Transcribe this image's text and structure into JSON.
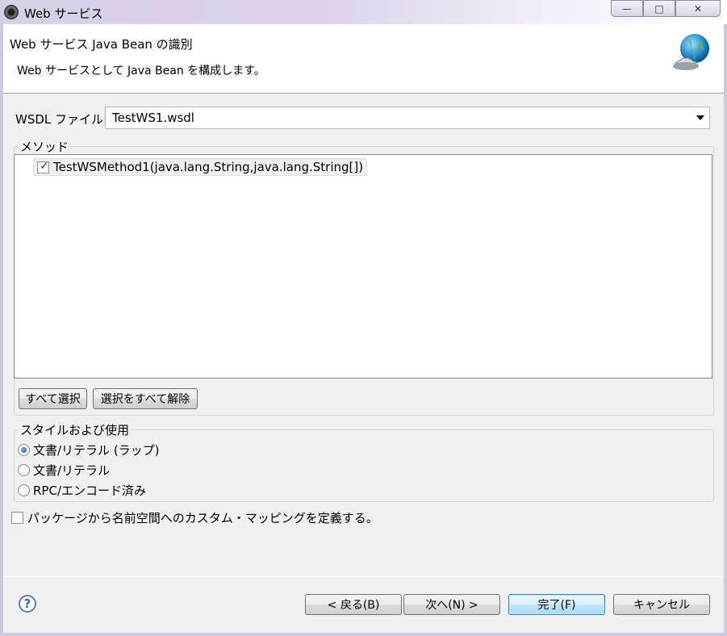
{
  "window": {
    "title": "Web サービス",
    "min_symbol": "—",
    "max_symbol": "□",
    "close_symbol": "✕"
  },
  "header": {
    "title": "Web サービス Java Bean の識別",
    "description": "Web サービスとして Java Bean を構成します。",
    "icon": "web-service-globe-icon"
  },
  "wsdl": {
    "label": "WSDL ファイル:",
    "value": "TestWS1.wsdl"
  },
  "methods": {
    "group_title": "メソッド",
    "items": [
      {
        "label": "TestWSMethod1(java.lang.String,java.lang.String[])",
        "checked": true
      }
    ],
    "select_all_label": "すべて選択",
    "deselect_all_label": "選択をすべて解除"
  },
  "style": {
    "group_title": "スタイルおよび使用",
    "options": [
      {
        "label": "文書/リテラル (ラップ)",
        "selected": true
      },
      {
        "label": "文書/リテラル",
        "selected": false
      },
      {
        "label": "RPC/エンコード済み",
        "selected": false
      }
    ]
  },
  "custom_mapping": {
    "label": "パッケージから名前空間へのカスタム・マッピングを定義する。",
    "checked": false
  },
  "footer": {
    "help_symbol": "?",
    "back_label": "< 戻る(B)",
    "next_label": "次へ(N) >",
    "finish_label": "完了(F)",
    "cancel_label": "キャンセル"
  },
  "colors": {
    "titlebar": "#d7cfe6",
    "dialog_bg": "#f0f0f0",
    "accent": "#3c7fb1"
  }
}
